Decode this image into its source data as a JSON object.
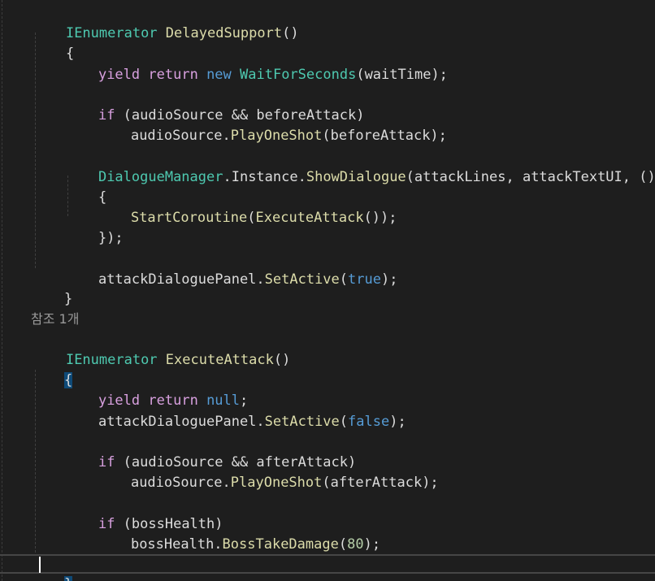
{
  "colors": {
    "background": "#1e1e1e",
    "plain": "#dcdcdc",
    "keyword": "#569cd6",
    "control": "#d8a0df",
    "type": "#4ec9b0",
    "method": "#dcdcaa",
    "number": "#b5cea8",
    "reference": "#999999"
  },
  "code": {
    "l1": {
      "t1": "IEnumerator",
      "t2": " ",
      "t3": "DelayedSupport",
      "t4": "()"
    },
    "l2": {
      "t1": "{"
    },
    "l3": {
      "t1": "yield",
      "t2": " ",
      "t3": "return",
      "t4": " ",
      "t5": "new",
      "t6": " ",
      "t7": "WaitForSeconds",
      "t8": "(waitTime);"
    },
    "l4": {
      "t1": "if",
      "t2": " (audioSource && beforeAttack)"
    },
    "l5": {
      "t1": "audioSource.",
      "t2": "PlayOneShot",
      "t3": "(beforeAttack);"
    },
    "l6": {
      "t1": "DialogueManager",
      "t2": ".Instance.",
      "t3": "ShowDialogue",
      "t4": "(attackLines, attackTextUI, () =>"
    },
    "l7": {
      "t1": "{"
    },
    "l8": {
      "t1": "StartCoroutine",
      "t2": "(",
      "t3": "ExecuteAttack",
      "t4": "());"
    },
    "l9": {
      "t1": "});"
    },
    "l10": {
      "t1": "attackDialoguePanel.",
      "t2": "SetActive",
      "t3": "(",
      "t4": "true",
      "t5": ");"
    },
    "l11": {
      "t1": "}"
    },
    "ref": "참조 1개",
    "l12": {
      "t1": "IEnumerator",
      "t2": " ",
      "t3": "ExecuteAttack",
      "t4": "()"
    },
    "l13": {
      "t1": "{"
    },
    "l14": {
      "t1": "yield",
      "t2": " ",
      "t3": "return",
      "t4": " ",
      "t5": "null",
      "t6": ";"
    },
    "l15": {
      "t1": "attackDialoguePanel.",
      "t2": "SetActive",
      "t3": "(",
      "t4": "false",
      "t5": ");"
    },
    "l16": {
      "t1": "if",
      "t2": " (audioSource && afterAttack)"
    },
    "l17": {
      "t1": "audioSource.",
      "t2": "PlayOneShot",
      "t3": "(afterAttack);"
    },
    "l18": {
      "t1": "if",
      "t2": " (bossHealth)"
    },
    "l19": {
      "t1": "bossHealth.",
      "t2": "BossTakeDamage",
      "t3": "(",
      "t4": "80",
      "t5": ");"
    },
    "l20": {
      "t1": "}"
    }
  }
}
